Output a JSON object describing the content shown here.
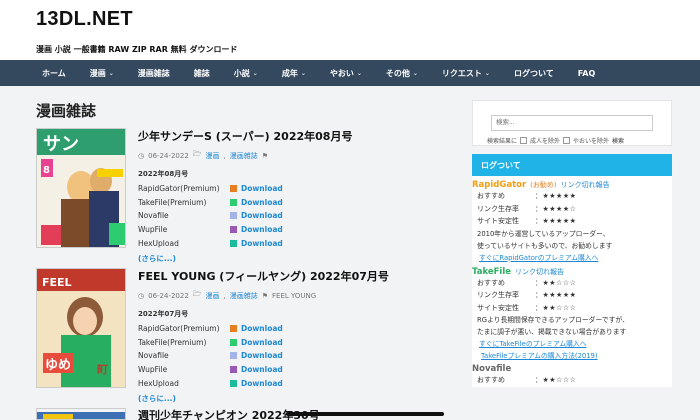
{
  "site": {
    "title": "13DL.NET",
    "description": "漫画 小説 一般書籍 RAW ZIP RAR 無料 ダウンロード"
  },
  "nav": [
    {
      "label": "ホーム",
      "dropdown": false
    },
    {
      "label": "漫画",
      "dropdown": true
    },
    {
      "label": "漫画雑誌",
      "dropdown": false
    },
    {
      "label": "雑誌",
      "dropdown": false
    },
    {
      "label": "小説",
      "dropdown": true
    },
    {
      "label": "成年",
      "dropdown": true
    },
    {
      "label": "やおい",
      "dropdown": true
    },
    {
      "label": "その他",
      "dropdown": true
    },
    {
      "label": "リクエスト",
      "dropdown": true
    },
    {
      "label": "ログついて",
      "dropdown": false
    },
    {
      "label": "FAQ",
      "dropdown": false
    }
  ],
  "page_title": "漫画雑誌",
  "posts": [
    {
      "title": "少年サンデーS (スーパー) 2022年08月号",
      "date": "06-24-2022",
      "categories": [
        "漫画",
        "漫画雑誌"
      ],
      "tags": [],
      "issue": "2022年08月号",
      "downloads": [
        {
          "host": "RapidGator(Premium)",
          "label": "Download",
          "color": "#e67e22"
        },
        {
          "host": "TakeFile(Premium)",
          "label": "Download",
          "color": "#2ecc71"
        },
        {
          "host": "Novafile",
          "label": "Download",
          "color": "#a5b4e8"
        },
        {
          "host": "WupFile",
          "label": "Download",
          "color": "#9b59b6"
        },
        {
          "host": "HexUpload",
          "label": "Download",
          "color": "#1abc9c"
        }
      ],
      "more": "(さらに...)"
    },
    {
      "title": "FEEL YOUNG (フィールヤング) 2022年07月号",
      "date": "06-24-2022",
      "categories": [
        "漫画",
        "漫画雑誌"
      ],
      "tags": [
        "FEEL YOUNG"
      ],
      "issue": "2022年07月号",
      "downloads": [
        {
          "host": "RapidGator(Premium)",
          "label": "Download",
          "color": "#e67e22"
        },
        {
          "host": "TakeFile(Premium)",
          "label": "Download",
          "color": "#2ecc71"
        },
        {
          "host": "Novafile",
          "label": "Download",
          "color": "#a5b4e8"
        },
        {
          "host": "WupFile",
          "label": "Download",
          "color": "#9b59b6"
        },
        {
          "host": "HexUpload",
          "label": "Download",
          "color": "#1abc9c"
        }
      ],
      "more": "(さらに...)"
    }
  ],
  "next_post_title": "週刊少年チャンピオン 2022年30号",
  "sidebar": {
    "search_placeholder": "検索...",
    "search_scope": "検索結果に",
    "opt_adult": "成人を除外",
    "opt_yaoi": "やおいを除外",
    "search_button": "検索",
    "widget_title": "ログついて",
    "rapidgator": {
      "name": "RapidGator",
      "note": "(お勧め)",
      "link": "リンク切れ報告",
      "rows": [
        {
          "k": "おすすめ",
          "v": "：★★★★★"
        },
        {
          "k": "リンク生存率",
          "v": "：★★★★☆"
        },
        {
          "k": "サイト安定性",
          "v": "：★★★★★"
        }
      ],
      "para1": "2010年から運営しているアップローダー、",
      "para2": "使っているサイトも多いので、お勧めします",
      "promo": "すぐにRapidGatorのプレミアム購入へ"
    },
    "takefile": {
      "name": "TakeFile",
      "link": "リンク切れ報告",
      "rows": [
        {
          "k": "おすすめ",
          "v": "：★★☆☆☆"
        },
        {
          "k": "リンク生存率",
          "v": "：★★★★★"
        },
        {
          "k": "サイト安定性",
          "v": "：★★☆☆☆"
        }
      ],
      "para1": "RGより長期間保存できるアップローダーですが、",
      "para2": "たまに調子が悪い、掲載できない場合があります",
      "promo1": "すぐにTakeFileのプレミアム購入へ",
      "promo2": "TakeFileプレミアムの購入方法(2019)"
    },
    "novafile": {
      "name": "Novafile",
      "rows": [
        {
          "k": "おすすめ",
          "v": "：★★☆☆☆"
        }
      ]
    },
    "colors": {
      "rapidgator": "#f39c12",
      "takefile": "#27ae60",
      "novafile": "#666666",
      "accent": "#1fb3e8"
    }
  }
}
